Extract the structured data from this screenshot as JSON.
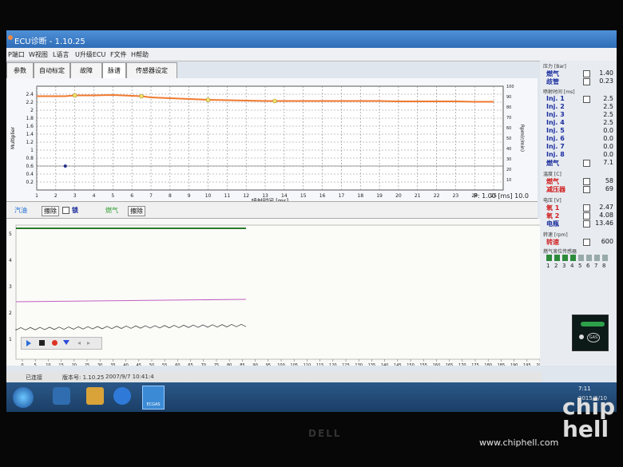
{
  "window": {
    "title": "ECU诊断 - 1.10.25",
    "menu": [
      "P端口",
      "W视图",
      "L语言",
      "U升级ECU",
      "F文件",
      "H帮助"
    ]
  },
  "tabs": [
    "参数",
    "自动标定",
    "故障",
    "脉谱",
    "传感器设定"
  ],
  "top_chart": {
    "y_label": "Multiplier",
    "y_right_label": "Rpm(r/min)",
    "x_label": "喷射时间 [ms]",
    "readout": "P: 1.00 [ms] 10.0"
  },
  "strip": {
    "left_label": "汽油",
    "erase1": "擦除",
    "lock_label": "锁",
    "gas_label": "燃气",
    "erase2": "擦除"
  },
  "right_panel": {
    "header1": "压力 [Bar]",
    "rows_pressure": [
      {
        "label": "燃气",
        "value": "1.40"
      },
      {
        "label": "歧管",
        "value": "0.23"
      }
    ],
    "header2": "喷射时间 [ms]",
    "injectors": [
      {
        "label": "Inj. 1",
        "value": "2.5"
      },
      {
        "label": "Inj. 2",
        "value": "2.5"
      },
      {
        "label": "Inj. 3",
        "value": "2.5"
      },
      {
        "label": "Inj. 4",
        "value": "2.5"
      },
      {
        "label": "Inj. 5",
        "value": "0.0"
      },
      {
        "label": "Inj. 6",
        "value": "0.0"
      },
      {
        "label": "Inj. 7",
        "value": "0.0"
      },
      {
        "label": "Inj. 8",
        "value": "0.0"
      },
      {
        "label": "燃气",
        "value": "7.1"
      }
    ],
    "header3": "温度 [C]",
    "temps": [
      {
        "label": "燃气",
        "value": "58"
      },
      {
        "label": "减压器",
        "value": "69"
      }
    ],
    "header4": "电压 [V]",
    "volts": [
      {
        "label": "氧 1",
        "value": "2.47"
      },
      {
        "label": "氧 2",
        "value": "4.08"
      },
      {
        "label": "电瓶",
        "value": "13.46"
      }
    ],
    "header5": "转速 [rpm]",
    "rpm": {
      "label": "转速",
      "value": "600"
    },
    "header6": "燃气液位传感器",
    "level_numbers": [
      "1",
      "2",
      "3",
      "4",
      "5",
      "6",
      "7",
      "8"
    ],
    "gas_badge": "GAS"
  },
  "status": {
    "connection": "已连接",
    "version": "版本号: 1.10.25",
    "datetime": "2007/9/7  10:41:4"
  },
  "lower_chart": {
    "y_ticks": [
      "5",
      "4",
      "3",
      "2",
      "1"
    ],
    "x_ticks": [
      "0",
      "5",
      "10",
      "15",
      "20",
      "25",
      "30",
      "35",
      "40",
      "45",
      "50",
      "55",
      "60",
      "65",
      "70",
      "75",
      "80",
      "85",
      "90",
      "95",
      "100",
      "105",
      "110",
      "115",
      "120",
      "125",
      "130",
      "135",
      "140",
      "145",
      "150",
      "155",
      "160",
      "165",
      "170",
      "175",
      "180",
      "185",
      "190",
      "195",
      "200"
    ]
  },
  "taskbar": {
    "clock": "7:11",
    "date": "2015/6/10",
    "app_label": "ECGAS"
  },
  "bezel": {
    "dell": "DELL",
    "watermark_url": "www.chiphell.com"
  },
  "chart_data": {
    "type": "line",
    "x": [
      1,
      2,
      2.5,
      3,
      4,
      5,
      6,
      6.5,
      7,
      8,
      9,
      10,
      11,
      12,
      13,
      13.5,
      14,
      15,
      16,
      17,
      18,
      19,
      20,
      21,
      22,
      23,
      24,
      25
    ],
    "series": [
      {
        "values": [
          2.35,
          2.35,
          2.35,
          2.37,
          2.37,
          2.38,
          2.36,
          2.35,
          2.32,
          2.3,
          2.28,
          2.26,
          2.25,
          2.24,
          2.23,
          2.23,
          2.23,
          2.23,
          2.23,
          2.23,
          2.23,
          2.23,
          2.22,
          2.22,
          2.22,
          2.22,
          2.21,
          2.21
        ]
      }
    ],
    "points": [
      {
        "x": 3,
        "y": 2.37
      },
      {
        "x": 6.5,
        "y": 2.35
      },
      {
        "x": 10,
        "y": 2.26
      },
      {
        "x": 13.5,
        "y": 2.23
      }
    ],
    "marker": {
      "x": 2.5,
      "y": 0.6
    },
    "xlabel": "喷射时间 [ms]",
    "ylabel": "Multiplier",
    "xlim": [
      1,
      25.5
    ],
    "ylim": [
      0,
      2.6
    ],
    "y2lim": [
      0,
      100
    ],
    "x_ticks": [
      1,
      2,
      3,
      4,
      5,
      6,
      7,
      8,
      9,
      10,
      11,
      12,
      13,
      14,
      15,
      16,
      17,
      18,
      19,
      20,
      21,
      22,
      23,
      24,
      25
    ],
    "y_ticks": [
      0.2,
      0.4,
      0.6,
      0.8,
      1,
      1.2,
      1.4,
      1.6,
      1.8,
      2,
      2.2,
      2.4
    ],
    "y2_ticks": [
      10,
      20,
      30,
      40,
      50,
      60,
      70,
      80,
      90,
      100
    ],
    "grid": true,
    "line_color": "#f07a30",
    "point_color": "#f2e36a",
    "marker_color": "#1a2a9a"
  }
}
